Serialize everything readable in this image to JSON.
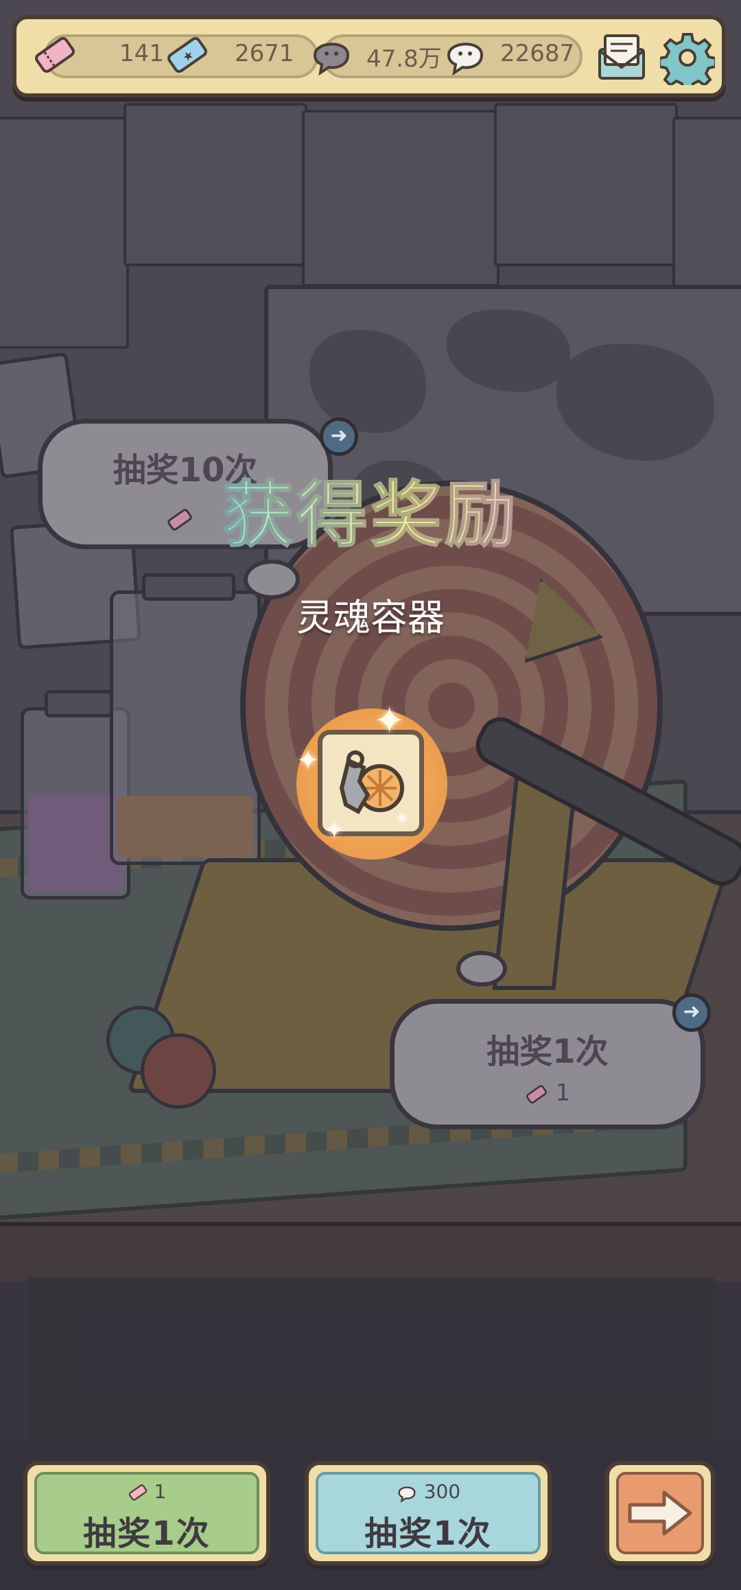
{
  "top_bar": {
    "ticket_pink": "141",
    "ticket_blue": "2671",
    "dark_soul": "47.8万",
    "light_soul": "22687"
  },
  "lottery_ten": {
    "title": "抽奖10次",
    "arrow": "➜"
  },
  "lottery_one": {
    "title": "抽奖1次",
    "cost": "1",
    "arrow": "➜"
  },
  "reward": {
    "heading": "获得奖励",
    "item_name": "灵魂容器"
  },
  "buttons": {
    "ticket_draw": {
      "cost": "1",
      "label": "抽奖1次",
      "color": "#a8cc8a"
    },
    "soul_draw": {
      "cost": "300",
      "label": "抽奖1次",
      "color": "#a7d6dd"
    },
    "next": {
      "icon": "right-arrow-icon"
    }
  },
  "colors": {
    "panel": "#f0dea9",
    "outline": "#4a3d34",
    "reward_glow": "#eea152"
  }
}
